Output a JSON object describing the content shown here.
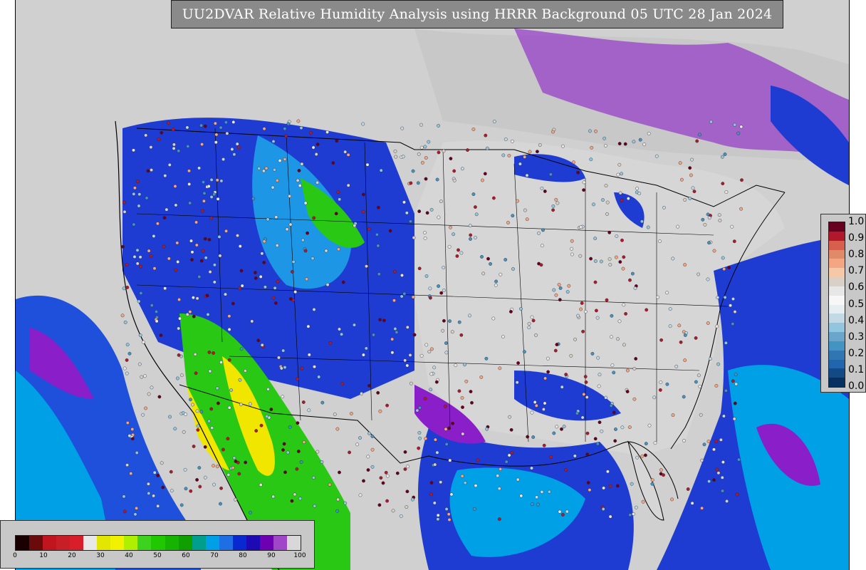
{
  "title": "UU2DVAR Relative Humidity Analysis using HRRR Background 05 UTC 28 Jan 2024",
  "obs_colorbar": {
    "ticks": [
      "1.0",
      "0.9",
      "0.8",
      "0.7",
      "0.6",
      "0.5",
      "0.4",
      "0.3",
      "0.2",
      "0.1",
      "0.0"
    ],
    "colors": [
      "#67001f",
      "#b2182b",
      "#d6604d",
      "#e08a6a",
      "#f4a582",
      "#f5c9a8",
      "#d9d0c8",
      "#e7e7e7",
      "#f7f7f7",
      "#e6eef2",
      "#c3d9e6",
      "#92c5de",
      "#6aa6cc",
      "#4393c3",
      "#2f76b2",
      "#2166ac",
      "#134a85",
      "#053061"
    ]
  },
  "rh_colorbar": {
    "ticks": [
      "0",
      "10",
      "20",
      "30",
      "40",
      "50",
      "60",
      "70",
      "80",
      "90",
      "100"
    ],
    "colors": [
      "#1a0000",
      "#6b0a0a",
      "#c0141e",
      "#c81e28",
      "#d81e2a",
      "#e8e8e8",
      "#e2e600",
      "#f2f200",
      "#aef000",
      "#3cd21e",
      "#20c800",
      "#14b400",
      "#0fa000",
      "#009e8c",
      "#00a0e6",
      "#1e6ee6",
      "#0a28d2",
      "#1e0ab4",
      "#6e00b4",
      "#a046c8",
      "#d8d8d8"
    ]
  },
  "map_colors": {
    "ocean_low": "#c8c8c8",
    "humid": "#1e3cd2",
    "very_humid": "#7a0ab4",
    "moderate": "#1e96e6",
    "dry": "#28c814",
    "very_dry": "#f0e600",
    "saturated": "#d4d4d4"
  }
}
